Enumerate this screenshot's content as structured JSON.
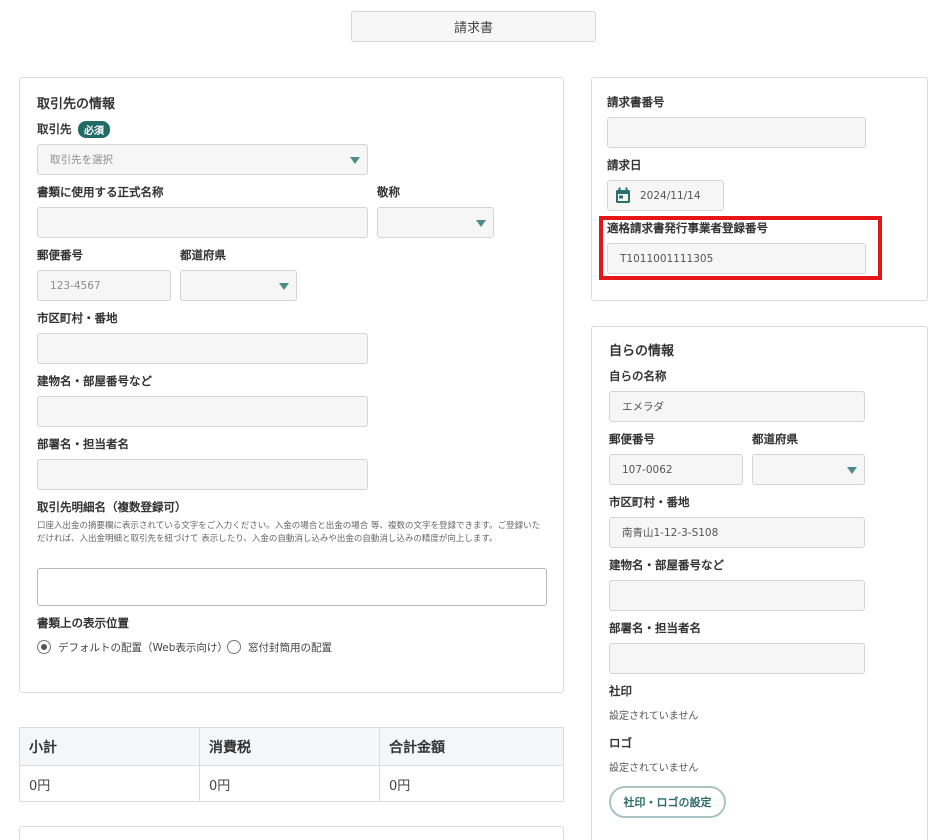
{
  "header": {
    "document_type": "請求書"
  },
  "client": {
    "title": "取引先の情報",
    "client_label": "取引先",
    "required_badge": "必須",
    "client_placeholder": "取引先を選択",
    "official_name_label": "書類に使用する正式名称",
    "honorific_label": "敬称",
    "postal_label": "郵便番号",
    "postal_placeholder": "123-4567",
    "prefecture_label": "都道府県",
    "city_label": "市区町村・番地",
    "building_label": "建物名・部屋番号など",
    "department_label": "部署名・担当者名",
    "detail_label": "取引先明細名（複数登録可）",
    "detail_hint": "口座入出金の摘要欄に表示されている文字をご入力ください。入金の場合と出金の場合 等、複数の文字を登録できます。ご登録いただければ、入出金明細と取引先を紐づけて 表示したり、入金の自動消し込みや出金の自動消し込みの精度が向上します。",
    "display_position_label": "書類上の表示位置",
    "radio_default": "デフォルトの配置（Web表示向け）",
    "radio_window": "窓付封筒用の配置"
  },
  "invoice": {
    "number_label": "請求書番号",
    "date_label": "請求日",
    "date_value": "2024/11/14",
    "registration_label": "適格請求書発行事業者登録番号",
    "registration_value": "T1011001111305"
  },
  "self": {
    "title": "自らの情報",
    "name_label": "自らの名称",
    "name_value": "エメラダ",
    "postal_label": "郵便番号",
    "postal_value": "107-0062",
    "prefecture_label": "都道府県",
    "city_label": "市区町村・番地",
    "city_value": "南青山1-12-3-S108",
    "building_label": "建物名・部屋番号など",
    "department_label": "部署名・担当者名",
    "seal_label": "社印",
    "seal_status": "設定されていません",
    "logo_label": "ロゴ",
    "logo_status": "設定されていません",
    "seal_logo_button": "社印・ロゴの設定"
  },
  "totals": {
    "subtotal_label": "小計",
    "tax_label": "消費税",
    "total_label": "合計金額",
    "subtotal_value": "0円",
    "tax_value": "0円",
    "total_value": "0円"
  },
  "colors": {
    "accent": "#1f6b66",
    "highlight": "#e4161a",
    "caret": "#4e8c8c"
  },
  "icons": {
    "calendar": "calendar-icon",
    "dropdown": "chevron-down-icon"
  }
}
